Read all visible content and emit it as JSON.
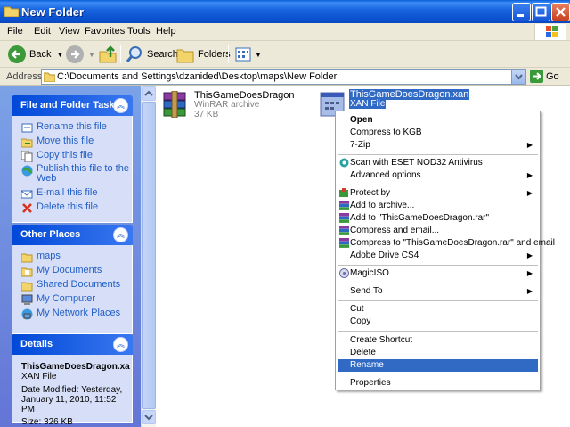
{
  "window": {
    "title": "New Folder"
  },
  "menubar": [
    "File",
    "Edit",
    "View",
    "Favorites",
    "Tools",
    "Help"
  ],
  "toolbar": {
    "back": "Back",
    "search": "Search",
    "folders": "Folders"
  },
  "address": {
    "label": "Address",
    "path": "C:\\Documents and Settings\\dzanided\\Desktop\\maps\\New Folder",
    "go": "Go"
  },
  "tasks": {
    "title": "File and Folder Tasks",
    "items": [
      "Rename this file",
      "Move this file",
      "Copy this file",
      "Publish this file to the Web",
      "E-mail this file",
      "Delete this file"
    ]
  },
  "places": {
    "title": "Other Places",
    "items": [
      "maps",
      "My Documents",
      "Shared Documents",
      "My Computer",
      "My Network Places"
    ]
  },
  "details": {
    "title": "Details",
    "name": "ThisGameDoesDragon.xa",
    "type": "XAN File",
    "modified": "Date Modified: Yesterday, January 11, 2010, 11:52 PM",
    "size": "Size: 326 KB"
  },
  "files": [
    {
      "name": "ThisGameDoesDragon",
      "type": "WinRAR archive",
      "size": "37 KB",
      "icon": "winrar-archive-icon"
    },
    {
      "name": "ThisGameDoesDragon.xan",
      "type": "XAN File",
      "icon": "xan-file-icon",
      "selected": true
    }
  ],
  "context_menu": [
    {
      "label": "Open",
      "bold": true
    },
    {
      "label": "Compress to KGB"
    },
    {
      "label": "7-Zip",
      "submenu": true
    },
    {
      "sep": true
    },
    {
      "label": "Scan with ESET NOD32 Antivirus",
      "icon": "eset-icon"
    },
    {
      "label": "Advanced options",
      "submenu": true
    },
    {
      "sep": true
    },
    {
      "label": "Protect by",
      "submenu": true,
      "icon": "protect-icon"
    },
    {
      "label": "Add to archive...",
      "icon": "winrar-icon"
    },
    {
      "label": "Add to \"ThisGameDoesDragon.rar\"",
      "icon": "winrar-icon"
    },
    {
      "label": "Compress and email...",
      "icon": "winrar-icon"
    },
    {
      "label": "Compress to \"ThisGameDoesDragon.rar\" and email",
      "icon": "winrar-icon"
    },
    {
      "label": "Adobe Drive CS4",
      "submenu": true
    },
    {
      "sep": true
    },
    {
      "label": "MagicISO",
      "submenu": true,
      "icon": "magiciso-icon"
    },
    {
      "sep": true
    },
    {
      "label": "Send To",
      "submenu": true
    },
    {
      "sep": true
    },
    {
      "label": "Cut"
    },
    {
      "label": "Copy"
    },
    {
      "sep": true
    },
    {
      "label": "Create Shortcut"
    },
    {
      "label": "Delete"
    },
    {
      "label": "Rename",
      "highlighted": true
    },
    {
      "sep": true
    },
    {
      "label": "Properties"
    }
  ],
  "colors": {
    "titlebar": "#0b52d0",
    "taskpane": "#6375d6",
    "highlight": "#316ac5",
    "link": "#215dc6"
  }
}
